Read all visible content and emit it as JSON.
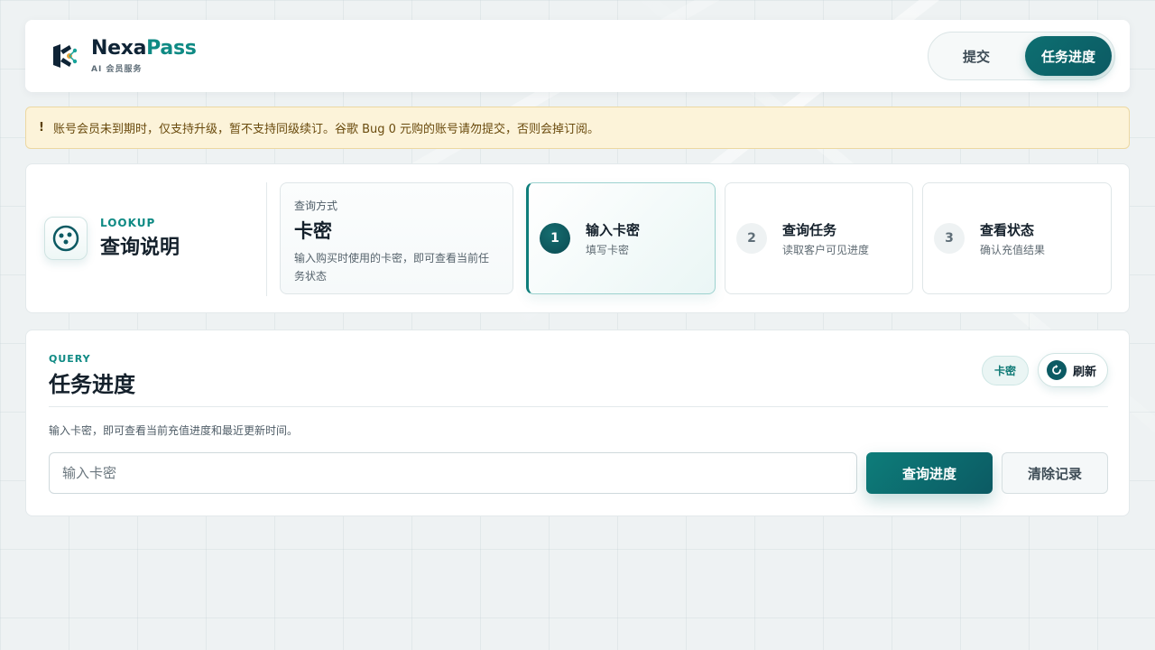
{
  "header": {
    "brand": {
      "name_part1": "Nexa",
      "name_part2": "Pass",
      "subtitle": "AI 会员服务"
    },
    "nav": {
      "submit_label": "提交",
      "progress_label": "任务进度",
      "active": "任务进度"
    }
  },
  "alert": {
    "icon": "!",
    "text": "账号会员未到期时，仅支持升级，暂不支持同级续订。谷歌 Bug 0 元购的账号请勿提交，否则会掉订阅。"
  },
  "lookup": {
    "eyebrow": "LOOKUP",
    "title": "查询说明",
    "method": {
      "label": "查询方式",
      "title": "卡密",
      "description": "输入购买时使用的卡密，即可查看当前任务状态"
    },
    "steps": [
      {
        "number": "1",
        "title": "输入卡密",
        "subtitle": "填写卡密",
        "active": true
      },
      {
        "number": "2",
        "title": "查询任务",
        "subtitle": "读取客户可见进度",
        "active": false
      },
      {
        "number": "3",
        "title": "查看状态",
        "subtitle": "确认充值结果",
        "active": false
      }
    ]
  },
  "query": {
    "eyebrow": "QUERY",
    "title": "任务进度",
    "chip_label": "卡密",
    "refresh_label": "刷新",
    "description": "输入卡密，即可查看当前充值进度和最近更新时间。",
    "input_placeholder": "输入卡密",
    "input_value": "",
    "submit_label": "查询进度",
    "clear_label": "清除记录"
  },
  "colors": {
    "accent": "#0d7d7a",
    "accent_dark": "#0c5a63",
    "alert_bg": "#fcf3d9"
  }
}
